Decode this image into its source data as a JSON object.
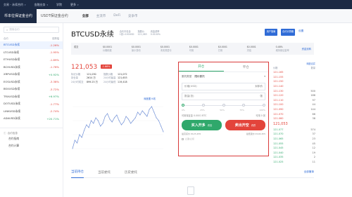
{
  "topnav": [
    {
      "label": "交易 - 永续合约",
      "caret": true
    },
    {
      "label": "金融业务",
      "caret": true
    },
    {
      "label": "学院",
      "caret": false
    },
    {
      "label": "更多",
      "caret": true
    }
  ],
  "contract_tabs": [
    "币本位保证金合约",
    "USDT保证金合约"
  ],
  "sub_tabs": [
    "全部",
    "主流币",
    "DeFi",
    "竞争币"
  ],
  "sidebar": {
    "search_placeholder": "搜索合约",
    "col_name": "合约",
    "col_change": "涨跌幅",
    "items": [
      {
        "name": "BTCUSD永续",
        "change": "-1.26%",
        "dir": "neg",
        "active": true
      },
      {
        "name": "LTCUSD永续",
        "change": "-1.95%",
        "dir": "neg",
        "active": false
      },
      {
        "name": "ETHUSD永续",
        "change": "-1.89%",
        "dir": "neg",
        "active": false
      },
      {
        "name": "BCHUSD永续",
        "change": "-1.76%",
        "dir": "neg",
        "active": false
      },
      {
        "name": "XRPUSD永续",
        "change": "+0.92%",
        "dir": "pos",
        "active": false
      },
      {
        "name": "EOSUSD永续",
        "change": "-3.38%",
        "dir": "neg",
        "active": false
      },
      {
        "name": "BSVUSD永续",
        "change": "-3.72%",
        "dir": "neg",
        "active": false
      },
      {
        "name": "TRXUSD永续",
        "change": "+6.97%",
        "dir": "pos",
        "active": false
      },
      {
        "name": "DOTUSD永续",
        "change": "-1.77%",
        "dir": "neg",
        "active": false
      },
      {
        "name": "LINKUSD永续",
        "change": "-2.74%",
        "dir": "neg",
        "active": false
      },
      {
        "name": "ADAUSD永续",
        "change": "+20.71%",
        "dir": "pos",
        "active": false
      }
    ],
    "section_title": "合约信息",
    "links": [
      "合约指南",
      "合约计算"
    ]
  },
  "header": {
    "pair": "BTCUSD永续",
    "info1_a": "合约中包含",
    "info1_b": "1张=100USD",
    "info2_a": "指数价",
    "info2_b": "121,083",
    "info3_a": "资金费率",
    "info3_b": "0.0100%",
    "btn_guide": "用户指南",
    "btn_calc": "合约计算器",
    "btn_settings": "设置"
  },
  "stats": [
    {
      "label": "成交",
      "value": ""
    },
    {
      "label": "$0.0001",
      "value": "价格精度"
    },
    {
      "label": "$0.0001",
      "value": "最小变动"
    },
    {
      "label": "$0.0001",
      "value": "未实现盈亏"
    },
    {
      "label": "$0.0001",
      "value": "可用"
    },
    {
      "label": "$0.0001",
      "value": "已用"
    },
    {
      "label": "$0.0001",
      "value": "冻结"
    },
    {
      "label": "0.48%",
      "value": "维持保证金率"
    }
  ],
  "stats_link": "资金划转",
  "price": {
    "last": "121,053",
    "change": "-1.66%",
    "kv": [
      {
        "k": "标记价格",
        "v": "121,030"
      },
      {
        "k": "指数价格",
        "v": "121,072"
      },
      {
        "k": "持仓量",
        "v": "2614 万"
      },
      {
        "k": "24小时最高",
        "v": "121,653"
      },
      {
        "k": "24小时成交",
        "v": "899.25 万"
      },
      {
        "k": "24小时最低",
        "v": "119,418"
      }
    ]
  },
  "chart_links": "深度图   K线",
  "chart_data": {
    "type": "line",
    "series": [
      {
        "values": [
          40,
          46,
          44,
          50,
          48,
          53,
          57,
          55,
          60,
          58,
          62,
          60,
          56,
          58,
          63,
          65,
          61,
          59,
          62,
          64,
          60,
          57,
          59,
          63,
          61,
          58,
          60,
          62,
          66,
          64,
          67,
          65,
          63,
          68,
          70,
          66,
          62,
          60,
          56,
          52
        ]
      }
    ],
    "xlabel": "",
    "ylabel": ""
  },
  "order_form": {
    "tab_open": "开仓",
    "tab_close": "平仓",
    "type_label": "委托类型",
    "type_value": "限价委托",
    "price_label": "价格(USD)",
    "price_unit": "对手价",
    "qty_label": "数量(张)",
    "qty_unit": "张",
    "pcts": [
      "0%",
      "25%",
      "50%",
      "75%",
      "100%"
    ],
    "avail_label": "可用保证金 0.0001 BTC",
    "leverage": "可用 0 张",
    "btn_long": "买入开多",
    "btn_long_sub": "看涨",
    "btn_short": "卖出开空",
    "btn_short_sub": "看跌",
    "long_amount": "最高买价 ¥123,455",
    "short_amount": "最低卖价 ¥118,455",
    "checkbox_label": "止盈/止损"
  },
  "book": {
    "tabs": "深度合并",
    "col_price": "价格",
    "col_qty": "数量",
    "asks": [
      {
        "p": "121.165",
        "v": ""
      },
      {
        "p": "121.155",
        "v": ""
      },
      {
        "p": "121.150",
        "v": ""
      },
      {
        "p": "121.140",
        "v": ""
      },
      {
        "p": "121.130",
        "v": "500"
      },
      {
        "p": "121.120",
        "v": "186"
      },
      {
        "p": "121.110",
        "v": "97"
      },
      {
        "p": "121.100",
        "v": "44"
      },
      {
        "p": "121.090",
        "v": "144"
      },
      {
        "p": "121.070",
        "v": "66"
      },
      {
        "p": "121.060",
        "v": "38"
      }
    ],
    "mid": "121,053",
    "bids": [
      {
        "p": "121.077",
        "v": "574"
      },
      {
        "p": "121.070",
        "v": "37"
      },
      {
        "p": "121.065",
        "v": "23"
      },
      {
        "p": "121.055",
        "v": "45"
      },
      {
        "p": "121.045",
        "v": "12"
      },
      {
        "p": "121.040",
        "v": "19"
      },
      {
        "p": "121.035",
        "v": "2"
      },
      {
        "p": "121.025",
        "v": "11"
      }
    ]
  },
  "bottom_tabs": [
    "当前持仓",
    "当前委托",
    "历史委托"
  ],
  "bottom_link": "全部撤单"
}
